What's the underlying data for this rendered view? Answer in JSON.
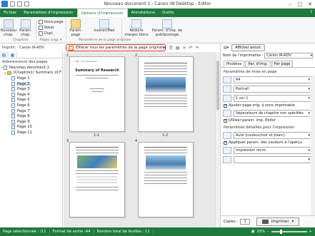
{
  "window": {
    "title": "Nouveau document 1 - Canon iW Desktop - Editor"
  },
  "ribbon_tabs": [
    "Fichier",
    "Paramètres d'impression",
    "Options d'impression",
    "Annotations",
    "Outils"
  ],
  "ribbon": {
    "nouveau_chap": "Nouveau\nchap.",
    "param_chap": "Param.\nchap.",
    "nouv_page": "Nouv.page",
    "rotat": "Rotat.",
    "dupl": "Dupl.",
    "param_page": "Param.\npage",
    "insertion": "Insérer/Mail",
    "reduire": "Réduire\nmarges blocs",
    "param_imp": "Param. d'imp. de\npublipostage",
    "group_chapitres": "Chapitres",
    "group_pages": "Pages origi. ▾",
    "group_param": "Paramètres de la page originale"
  },
  "tooltip": {
    "text": "Effacer tous les paramètres de la page originale"
  },
  "printer_bar": {
    "label": "Imprim. : Canon iR-ADV"
  },
  "left_pane": {
    "title": "Arborescence des pages",
    "root": "Nouveau document 1",
    "chapter": "(Chapitre1) Summary of F",
    "pages": [
      "Page 1",
      "Page 2",
      "Page 3",
      "Page 4",
      "Page 5",
      "Page 6",
      "Page 7",
      "Page 8",
      "Page 9",
      "Page 10",
      "Page 11"
    ]
  },
  "center": {
    "thumb_labels": [
      "1-1",
      "1-2"
    ],
    "page_numbers": [
      "1",
      "2",
      "3",
      "4"
    ],
    "cover_title": "Summary of Research"
  },
  "right_pane": {
    "afficher_button": "Afficher annot.",
    "printer_label": "Nom de l'imprimante :",
    "printer_value": "Canon iR-ADV",
    "tabs": [
      "Modèles",
      "Par. d'img.",
      "Par page"
    ],
    "section_mise_en_page": "Paramètres de mise en page",
    "paper_size": "A4",
    "orientation": "Portrait",
    "pages_per_sheet": "1 sur 1",
    "check_ajuster": "Ajuster page orig. à zone imprimable",
    "separator": "Séparateurs de chapitre non spécifiés",
    "check_editeur": "Utiliser param. imp. Editor",
    "section_details": "Paramètres détaillés pour l'impression",
    "color_mode": "Auto (couleur/noir et blanc)",
    "check_appliquer": "Appliquer param. des couleurs à l'aperçu",
    "print_side": "Impression recto",
    "copies_label": "Copies :",
    "copies_value": "1",
    "imprimer_button": "Imprimer"
  },
  "status": {
    "selected": "Page sélectionnée : /11",
    "format": "Format de sortie :A4",
    "total": "Nombre total de feuilles : 11",
    "zoom": "25%"
  }
}
